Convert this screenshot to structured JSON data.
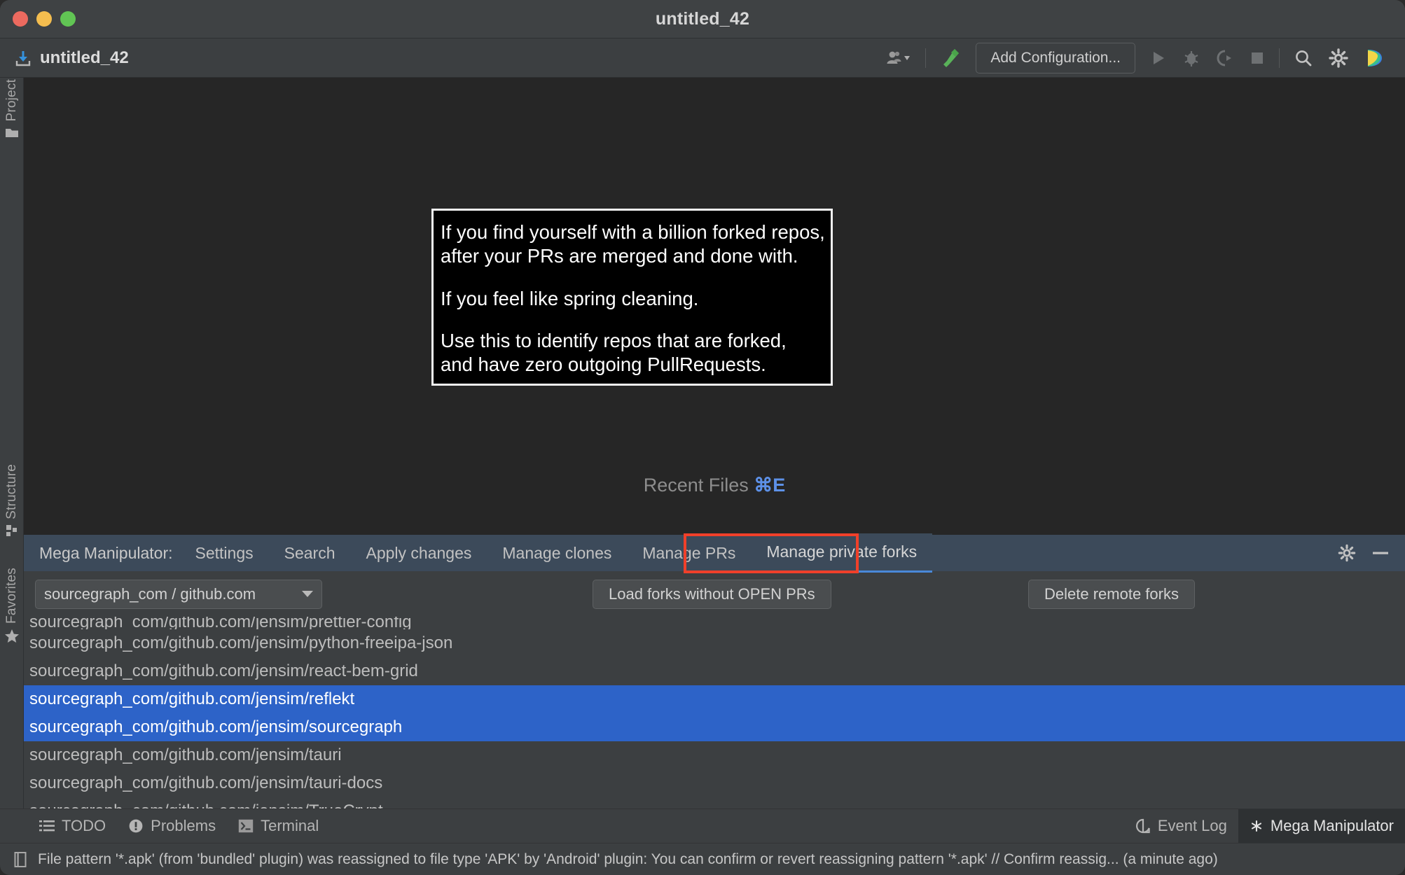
{
  "window": {
    "title": "untitled_42",
    "traffic_lights": [
      "close-red",
      "minimize-yellow",
      "maximize-green"
    ]
  },
  "toolbar": {
    "project_name": "untitled_42",
    "project_icon": "download-project-icon",
    "add_configuration_label": "Add Configuration...",
    "icons": [
      "user-dropdown-icon",
      "build-hammer-icon",
      "run-icon",
      "debug-icon",
      "run-with-coverage-icon",
      "stop-icon",
      "search-everywhere-icon",
      "settings-gear-icon",
      "jetbrains-logo-icon"
    ]
  },
  "left_strip": {
    "tabs": [
      {
        "label": "Project",
        "icon": "folder-icon"
      },
      {
        "label": "Structure",
        "icon": "structure-icon"
      },
      {
        "label": "Favorites",
        "icon": "star-icon"
      }
    ]
  },
  "editor": {
    "recent_files_hint": "Recent Files",
    "recent_files_shortcut": "⌘E",
    "overlay": {
      "paragraphs": [
        "If you find yourself with a billion forked repos,\nafter your PRs are merged and done with.",
        "If you feel like spring cleaning.",
        "Use this to identify repos that are forked,\nand have zero outgoing PullRequests."
      ]
    }
  },
  "mega_manipulator": {
    "title": "Mega Manipulator:",
    "tabs": [
      {
        "label": "Settings",
        "active": false
      },
      {
        "label": "Search",
        "active": false
      },
      {
        "label": "Apply changes",
        "active": false
      },
      {
        "label": "Manage clones",
        "active": false
      },
      {
        "label": "Manage PRs",
        "active": false
      },
      {
        "label": "Manage private forks",
        "active": true
      }
    ],
    "header_actions": [
      "settings-gear-icon",
      "minimize-icon"
    ],
    "annotation_color": "#f0402a",
    "accent_color": "#4a88d8",
    "selection_color": "#2d63c8",
    "source_select": {
      "value": "sourcegraph_com / github.com",
      "icon": "chevron-down-icon"
    },
    "load_button_label": "Load forks without OPEN PRs",
    "delete_button_label": "Delete remote forks",
    "repos": [
      {
        "name": "sourcegraph_com/github.com/jensim/prettier-config",
        "selected": false,
        "clipped": true
      },
      {
        "name": "sourcegraph_com/github.com/jensim/python-freeipa-json",
        "selected": false,
        "clipped": false
      },
      {
        "name": "sourcegraph_com/github.com/jensim/react-bem-grid",
        "selected": false,
        "clipped": false
      },
      {
        "name": "sourcegraph_com/github.com/jensim/reflekt",
        "selected": true,
        "clipped": false
      },
      {
        "name": "sourcegraph_com/github.com/jensim/sourcegraph",
        "selected": true,
        "clipped": false
      },
      {
        "name": "sourcegraph_com/github.com/jensim/tauri",
        "selected": false,
        "clipped": false
      },
      {
        "name": "sourcegraph_com/github.com/jensim/tauri-docs",
        "selected": false,
        "clipped": false
      },
      {
        "name": "sourcegraph_com/github.com/jensim/TrueCrypt",
        "selected": false,
        "clipped": false
      }
    ]
  },
  "bottom_tabs": {
    "left": [
      {
        "label": "TODO",
        "icon": "todo-list-icon",
        "active": false
      },
      {
        "label": "Problems",
        "icon": "problems-warning-icon",
        "active": false
      },
      {
        "label": "Terminal",
        "icon": "terminal-icon",
        "active": false
      }
    ],
    "right": [
      {
        "label": "Event Log",
        "icon": "event-log-icon",
        "active": false
      },
      {
        "label": "Mega Manipulator",
        "icon": "asterisk-icon",
        "active": true
      }
    ]
  },
  "status_bar": {
    "icon": "notification-document-icon",
    "message": "File pattern '*.apk' (from 'bundled' plugin) was reassigned to file type 'APK' by 'Android' plugin: You can confirm or revert reassigning pattern '*.apk' // Confirm reassig... (a minute ago)"
  }
}
